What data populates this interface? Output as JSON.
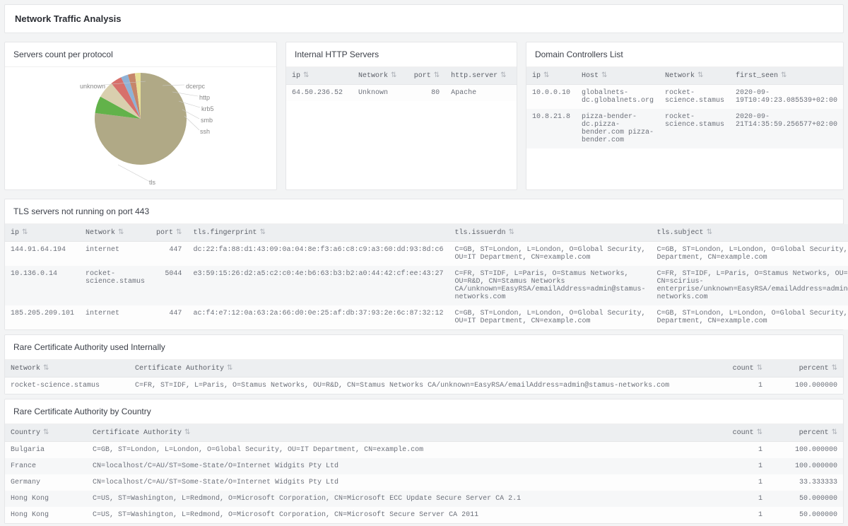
{
  "page_title": "Network Traffic Analysis",
  "panels": {
    "pie": {
      "title": "Servers count per protocol"
    },
    "http": {
      "title": "Internal HTTP Servers"
    },
    "dc": {
      "title": "Domain Controllers List"
    },
    "tls": {
      "title": "TLS servers not running on port 443"
    },
    "ca_int": {
      "title": "Rare Certificate Authority used Internally"
    },
    "ca_ctry": {
      "title": "Rare Certificate Authority by Country"
    }
  },
  "chart_data": {
    "type": "pie",
    "title": "Servers count per protocol",
    "series": [
      {
        "name": "tls",
        "value": 78,
        "color": "#b0a986"
      },
      {
        "name": "unknown",
        "value": 6,
        "color": "#62b24a"
      },
      {
        "name": "dcerpc",
        "value": 6,
        "color": "#d9cfae"
      },
      {
        "name": "http",
        "value": 4,
        "color": "#d7706b"
      },
      {
        "name": "krb5",
        "value": 2,
        "color": "#8fb2d6"
      },
      {
        "name": "smb",
        "value": 2,
        "color": "#c6866a"
      },
      {
        "name": "ssh",
        "value": 2,
        "color": "#e7e098"
      }
    ]
  },
  "http_cols": {
    "ip": "ip",
    "net": "Network",
    "port": "port",
    "srv": "http.server"
  },
  "http_rows": [
    {
      "ip": "64.50.236.52",
      "net": "Unknown",
      "port": "80",
      "srv": "Apache"
    }
  ],
  "dc_cols": {
    "ip": "ip",
    "host": "Host",
    "net": "Network",
    "first": "first_seen"
  },
  "dc_rows": [
    {
      "ip": "10.0.0.10",
      "host": "globalnets-dc.globalnets.org",
      "net": "rocket-science.stamus",
      "first": "2020-09-19T10:49:23.085539+02:00"
    },
    {
      "ip": "10.8.21.8",
      "host": "pizza-bender-dc.pizza-bender.com pizza-bender.com",
      "net": "rocket-science.stamus",
      "first": "2020-09-21T14:35:59.256577+02:00"
    }
  ],
  "tls_cols": {
    "ip": "ip",
    "net": "Network",
    "port": "port",
    "fp": "tls.fingerprint",
    "issuer": "tls.issuerdn",
    "subj": "tls.subject"
  },
  "tls_rows": [
    {
      "ip": "144.91.64.194",
      "net": "internet",
      "port": "447",
      "fp": "dc:22:fa:88:d1:43:09:0a:04:8e:f3:a6:c8:c9:a3:60:dd:93:8d:c6",
      "issuer": "C=GB, ST=London, L=London, O=Global Security, OU=IT Department, CN=example.com",
      "subj": "C=GB, ST=London, L=London, O=Global Security, OU=IT Department, CN=example.com"
    },
    {
      "ip": "10.136.0.14",
      "net": "rocket-science.stamus",
      "port": "5044",
      "fp": "e3:59:15:26:d2:a5:c2:c0:4e:b6:63:b3:b2:a0:44:42:cf:ee:43:27",
      "issuer": "C=FR, ST=IDF, L=Paris, O=Stamus Networks, OU=R&D, CN=Stamus Networks CA/unknown=EasyRSA/emailAddress=admin@stamus-networks.com",
      "subj": "C=FR, ST=IDF, L=Paris, O=Stamus Networks, OU=R&D, CN=scirius-enterprise/unknown=EasyRSA/emailAddress=admin@stamus-networks.com"
    },
    {
      "ip": "185.205.209.101",
      "net": "internet",
      "port": "447",
      "fp": "ac:f4:e7:12:0a:63:2a:66:d0:0e:25:af:db:37:93:2e:6c:87:32:12",
      "issuer": "C=GB, ST=London, L=London, O=Global Security, OU=IT Department, CN=example.com",
      "subj": "C=GB, ST=London, L=London, O=Global Security, OU=IT Department, CN=example.com"
    }
  ],
  "ca_int_cols": {
    "net": "Network",
    "ca": "Certificate Authority",
    "count": "count",
    "pct": "percent"
  },
  "ca_int_rows": [
    {
      "net": "rocket-science.stamus",
      "ca": "C=FR, ST=IDF, L=Paris, O=Stamus Networks, OU=R&D, CN=Stamus Networks CA/unknown=EasyRSA/emailAddress=admin@stamus-networks.com",
      "count": "1",
      "pct": "100.000000"
    }
  ],
  "ca_ctry_cols": {
    "ctry": "Country",
    "ca": "Certificate Authority",
    "count": "count",
    "pct": "percent"
  },
  "ca_ctry_rows": [
    {
      "ctry": "Bulgaria",
      "ca": "C=GB, ST=London, L=London, O=Global Security, OU=IT Department, CN=example.com",
      "count": "1",
      "pct": "100.000000"
    },
    {
      "ctry": "France",
      "ca": "CN=localhost/C=AU/ST=Some-State/O=Internet Widgits Pty Ltd",
      "count": "1",
      "pct": "100.000000"
    },
    {
      "ctry": "Germany",
      "ca": "CN=localhost/C=AU/ST=Some-State/O=Internet Widgits Pty Ltd",
      "count": "1",
      "pct": "33.333333"
    },
    {
      "ctry": "Hong Kong",
      "ca": "C=US, ST=Washington, L=Redmond, O=Microsoft Corporation, CN=Microsoft ECC Update Secure Server CA 2.1",
      "count": "1",
      "pct": "50.000000"
    },
    {
      "ctry": "Hong Kong",
      "ca": "C=US, ST=Washington, L=Redmond, O=Microsoft Corporation, CN=Microsoft Secure Server CA 2011",
      "count": "1",
      "pct": "50.000000"
    }
  ]
}
